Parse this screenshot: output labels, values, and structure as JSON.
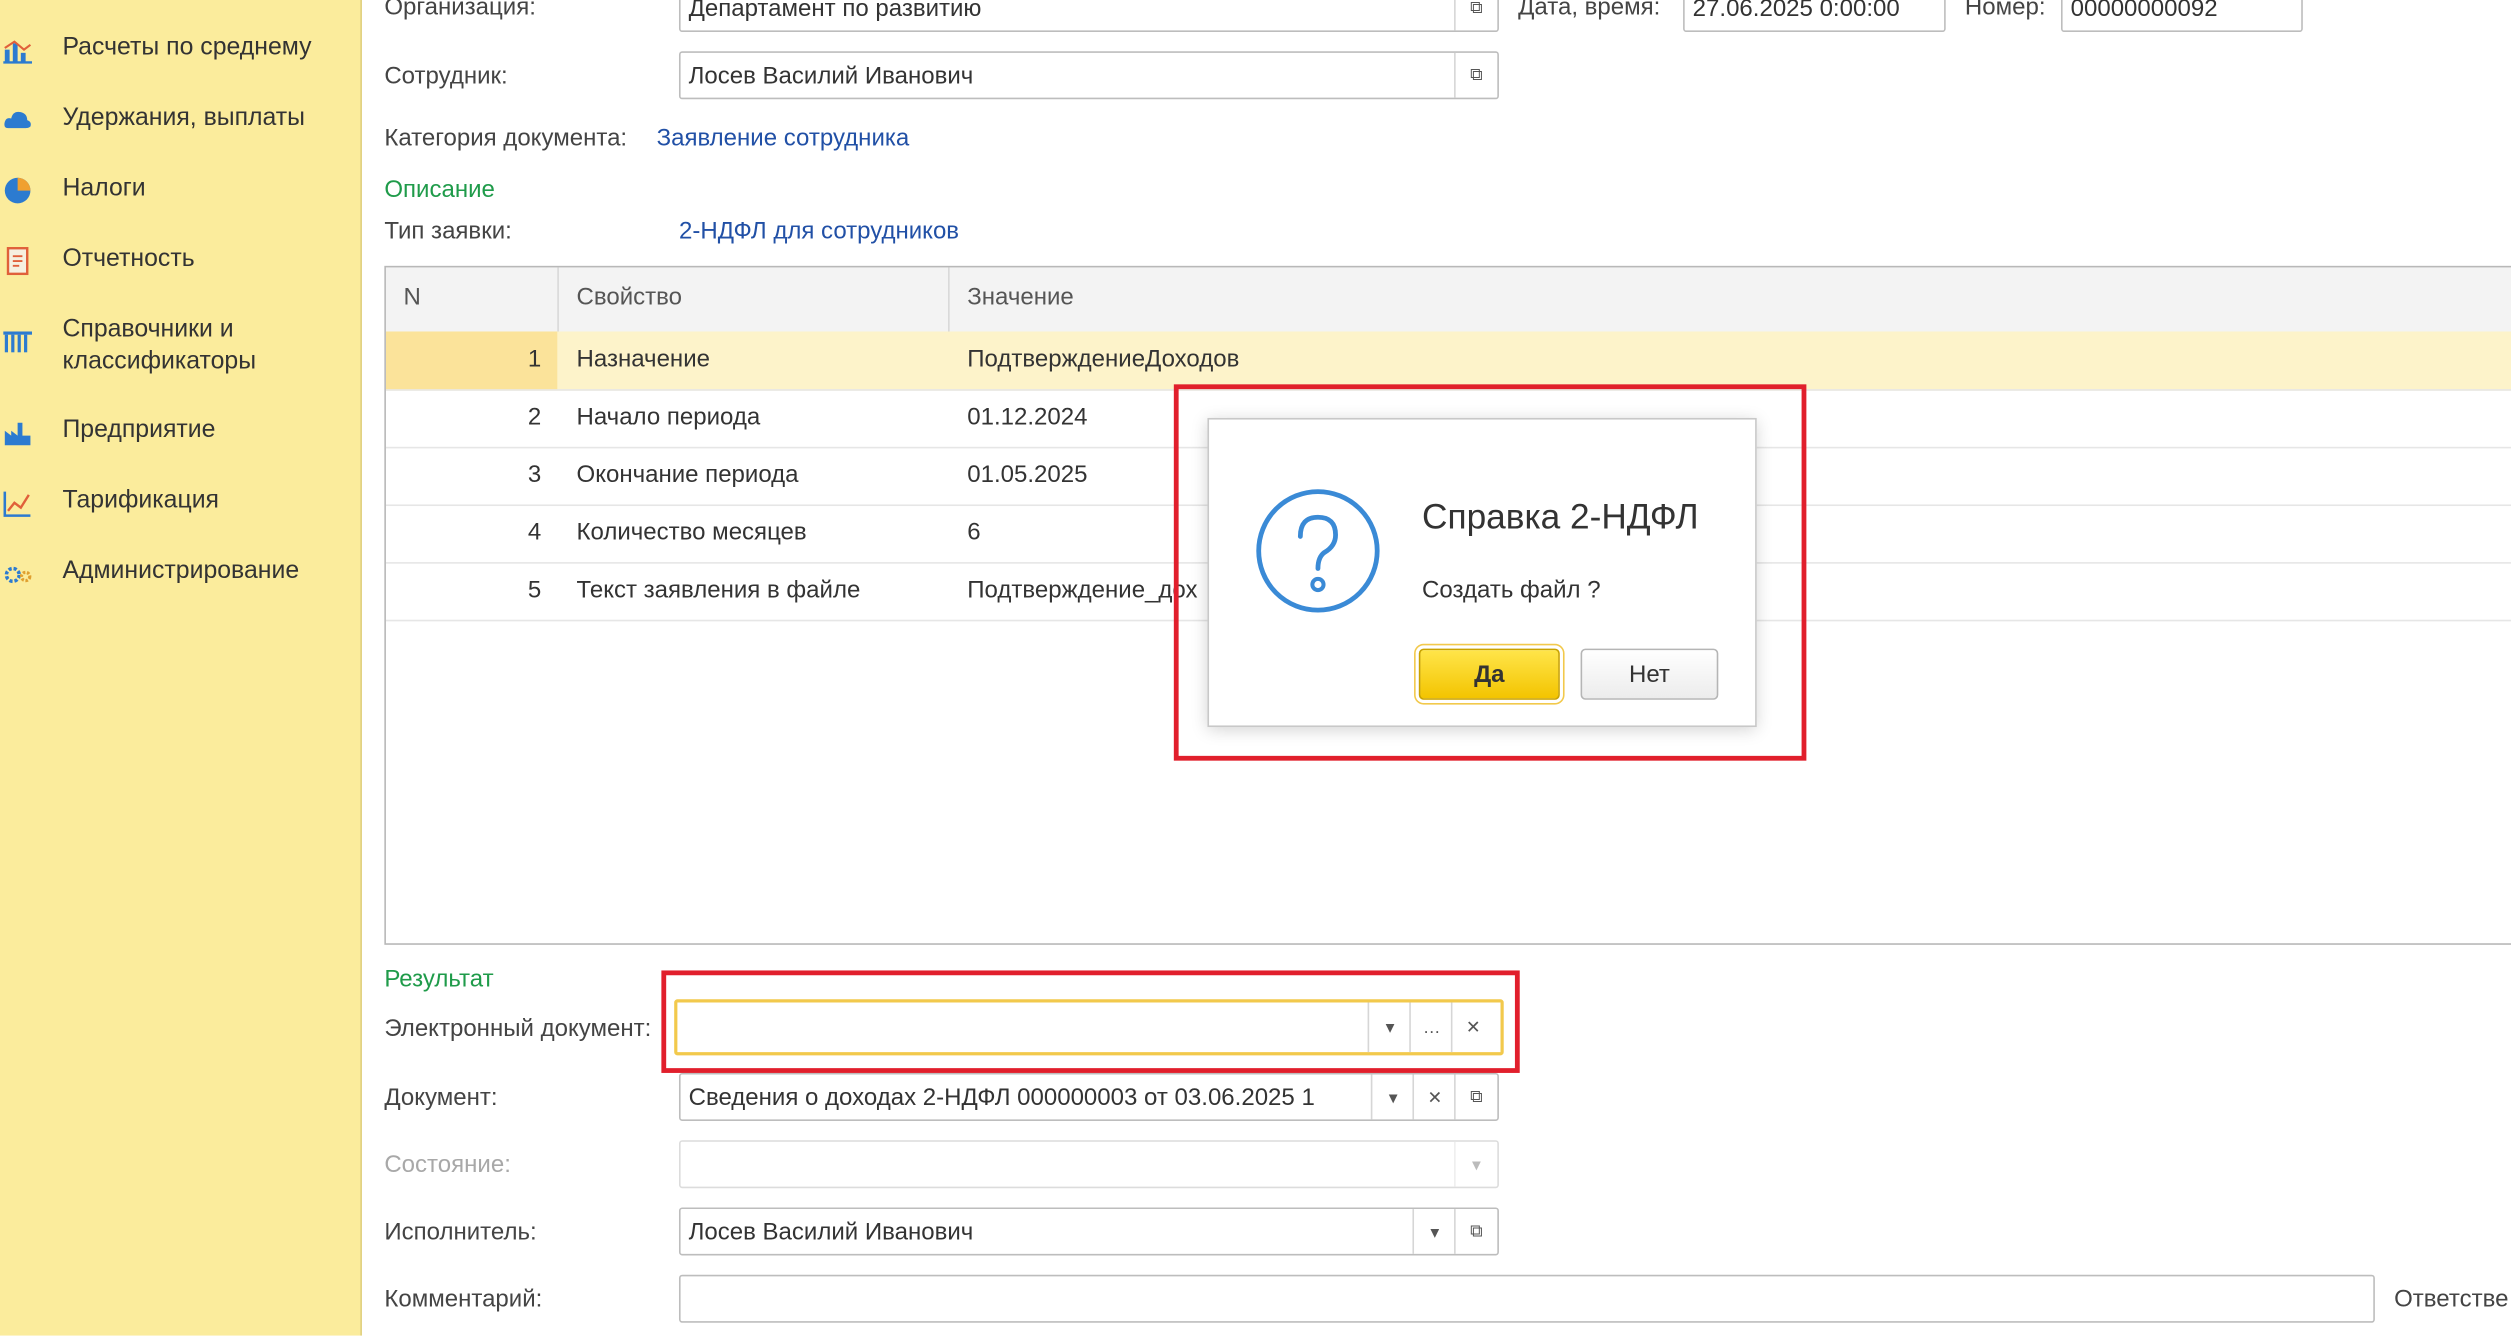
{
  "sidebar": {
    "items": [
      {
        "label": "Расчеты по среднему",
        "icon": "chart-icon"
      },
      {
        "label": "Удержания, выплаты",
        "icon": "cloud-icon"
      },
      {
        "label": "Налоги",
        "icon": "pie-icon"
      },
      {
        "label": "Отчетность",
        "icon": "report-icon"
      },
      {
        "label": "Справочники и",
        "label2": "классификаторы",
        "icon": "catalog-icon"
      },
      {
        "label": "Предприятие",
        "icon": "factory-icon"
      },
      {
        "label": "Тарификация",
        "icon": "tariff-icon"
      },
      {
        "label": "Администрирование",
        "icon": "gears-icon"
      }
    ]
  },
  "form": {
    "org_label": "Организация:",
    "org_value": "Департамент по развитию",
    "date_label": "Дата, время:",
    "date_value": "27.06.2025  0:00:00",
    "number_label": "Номер:",
    "number_value": "00000000092",
    "employee_label": "Сотрудник:",
    "employee_value": "Лосев Василий Иванович",
    "category_label": "Категория документа:",
    "category_value": "Заявление сотрудника",
    "description_group": "Описание",
    "request_type_label": "Тип заявки:",
    "request_type_value": "2-НДФЛ для сотрудников",
    "result_group": "Результат",
    "edoc_label": "Электронный документ:",
    "edoc_value": "",
    "document_label": "Документ:",
    "document_value": "Сведения о доходах 2-НДФЛ 000000003 от 03.06.2025 1",
    "state_label": "Состояние:",
    "state_value": "",
    "executor_label": "Исполнитель:",
    "executor_value": "Лосев Василий Иванович",
    "comment_label": "Комментарий:",
    "comment_value": "",
    "responsible_label": "Ответстве"
  },
  "table": {
    "headers": [
      "N",
      "Свойство",
      "Значение"
    ],
    "rows": [
      {
        "n": "1",
        "property": "Назначение",
        "value": "ПодтверждениеДоходов"
      },
      {
        "n": "2",
        "property": "Начало периода",
        "value": "01.12.2024"
      },
      {
        "n": "3",
        "property": "Окончание периода",
        "value": "01.05.2025"
      },
      {
        "n": "4",
        "property": "Количество месяцев",
        "value": "6"
      },
      {
        "n": "5",
        "property": "Текст заявления в файле",
        "value": "Подтверждение_дох"
      }
    ]
  },
  "dialog": {
    "title": "Справка 2-НДФЛ",
    "message": "Создать файл ?",
    "yes_label": "Да",
    "no_label": "Нет"
  },
  "colors": {
    "sidebar_bg": "#fbec9c",
    "accent_red": "#e11f2c",
    "link_blue": "#2150a6",
    "group_green": "#1f9b4a",
    "button_yellow": "#f3c400"
  }
}
